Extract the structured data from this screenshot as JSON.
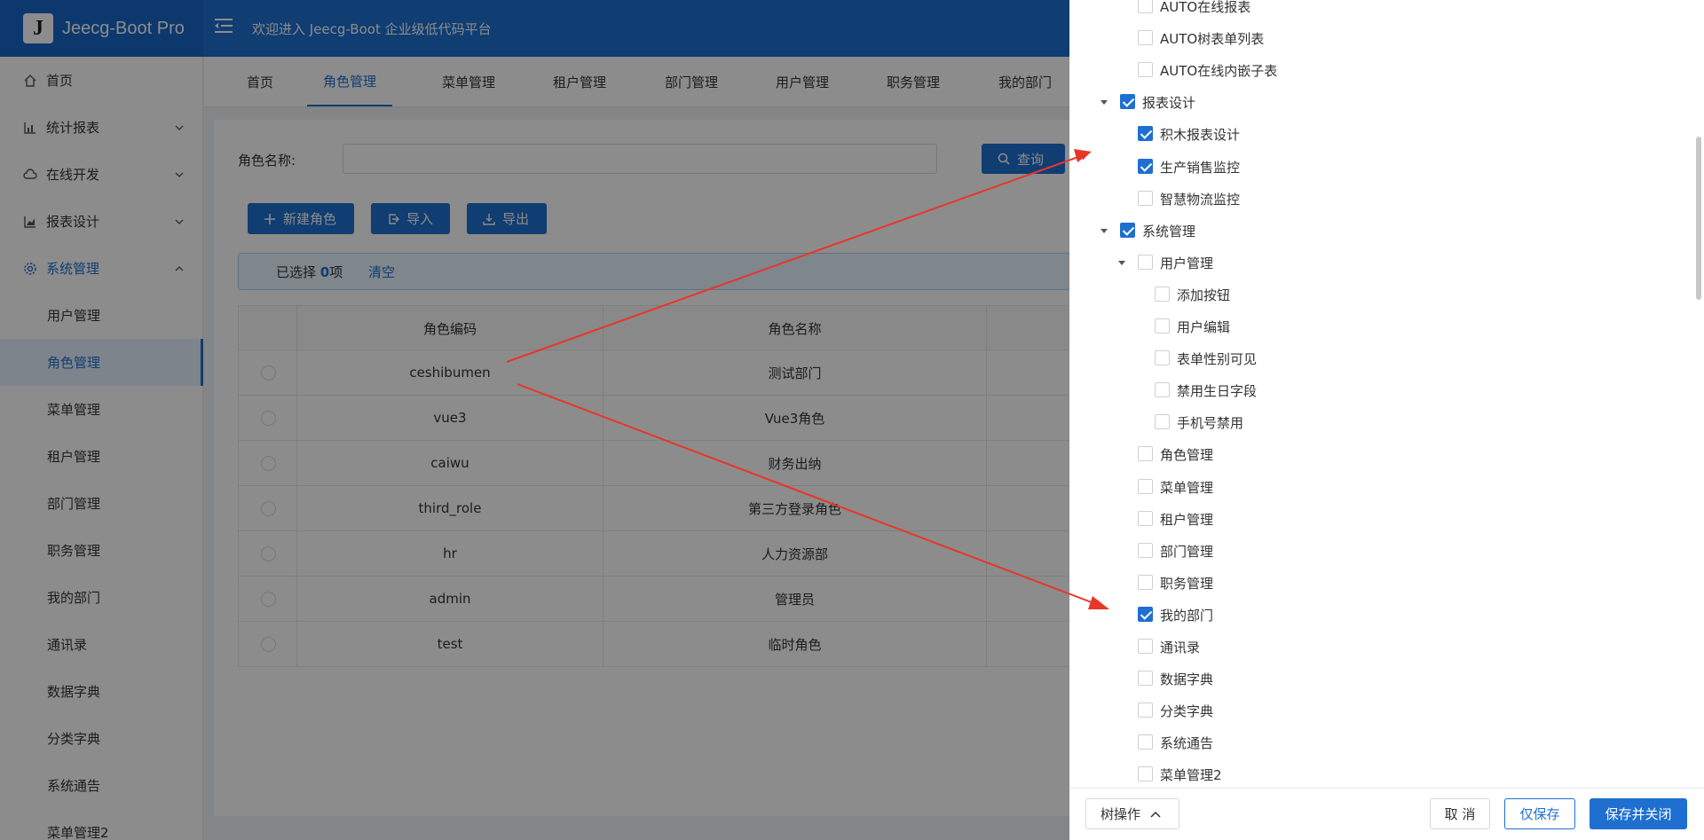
{
  "app": {
    "logo_letter": "J",
    "name": "Jeecg-Boot Pro",
    "welcome": "欢迎进入 Jeecg-Boot 企业级低代码平台"
  },
  "sidebar": {
    "top": [
      {
        "label": "首页",
        "icon": "home-icon"
      },
      {
        "label": "统计报表",
        "icon": "bar-chart-icon"
      },
      {
        "label": "在线开发",
        "icon": "cloud-icon"
      },
      {
        "label": "报表设计",
        "icon": "area-chart-icon"
      },
      {
        "label": "系统管理",
        "icon": "gear-icon"
      }
    ],
    "sub": [
      "用户管理",
      "角色管理",
      "菜单管理",
      "租户管理",
      "部门管理",
      "职务管理",
      "我的部门",
      "通讯录",
      "数据字典",
      "分类字典",
      "系统通告",
      "菜单管理2"
    ]
  },
  "tabs": [
    "首页",
    "角色管理",
    "菜单管理",
    "租户管理",
    "部门管理",
    "用户管理",
    "职务管理",
    "我的部门"
  ],
  "search": {
    "label": "角色名称:",
    "value": "",
    "query_button": "查询"
  },
  "toolbar": {
    "new_role": "新建角色",
    "import": "导入",
    "export": "导出"
  },
  "selection": {
    "prefix": "已选择",
    "count": "0",
    "suffix": "项",
    "clear": "清空"
  },
  "table": {
    "headers": [
      "角色编码",
      "角色名称"
    ],
    "rows": [
      {
        "code": "ceshibumen",
        "name": "测试部门"
      },
      {
        "code": "vue3",
        "name": "Vue3角色"
      },
      {
        "code": "caiwu",
        "name": "财务出纳"
      },
      {
        "code": "third_role",
        "name": "第三方登录角色"
      },
      {
        "code": "hr",
        "name": "人力资源部"
      },
      {
        "code": "admin",
        "name": "管理员"
      },
      {
        "code": "test",
        "name": "临时角色"
      }
    ]
  },
  "tree": [
    {
      "label": "AUTO在线报表",
      "level": 2,
      "checked": false,
      "caret": false
    },
    {
      "label": "AUTO树表单列表",
      "level": 2,
      "checked": false,
      "caret": false
    },
    {
      "label": "AUTO在线内嵌子表",
      "level": 2,
      "checked": false,
      "caret": false
    },
    {
      "label": "报表设计",
      "level": 1,
      "checked": true,
      "caret": true
    },
    {
      "label": "积木报表设计",
      "level": 2,
      "checked": true,
      "caret": false
    },
    {
      "label": "生产销售监控",
      "level": 2,
      "checked": true,
      "caret": false
    },
    {
      "label": "智慧物流监控",
      "level": 2,
      "checked": false,
      "caret": false
    },
    {
      "label": "系统管理",
      "level": 1,
      "checked": true,
      "caret": true
    },
    {
      "label": "用户管理",
      "level": 2,
      "checked": false,
      "caret": true
    },
    {
      "label": "添加按钮",
      "level": 3,
      "checked": false,
      "caret": false
    },
    {
      "label": "用户编辑",
      "level": 3,
      "checked": false,
      "caret": false
    },
    {
      "label": "表单性别可见",
      "level": 3,
      "checked": false,
      "caret": false
    },
    {
      "label": "禁用生日字段",
      "level": 3,
      "checked": false,
      "caret": false
    },
    {
      "label": "手机号禁用",
      "level": 3,
      "checked": false,
      "caret": false
    },
    {
      "label": "角色管理",
      "level": 2,
      "checked": false,
      "caret": false
    },
    {
      "label": "菜单管理",
      "level": 2,
      "checked": false,
      "caret": false
    },
    {
      "label": "租户管理",
      "level": 2,
      "checked": false,
      "caret": false
    },
    {
      "label": "部门管理",
      "level": 2,
      "checked": false,
      "caret": false
    },
    {
      "label": "职务管理",
      "level": 2,
      "checked": false,
      "caret": false
    },
    {
      "label": "我的部门",
      "level": 2,
      "checked": true,
      "caret": false
    },
    {
      "label": "通讯录",
      "level": 2,
      "checked": false,
      "caret": false
    },
    {
      "label": "数据字典",
      "level": 2,
      "checked": false,
      "caret": false
    },
    {
      "label": "分类字典",
      "level": 2,
      "checked": false,
      "caret": false
    },
    {
      "label": "系统通告",
      "level": 2,
      "checked": false,
      "caret": false
    },
    {
      "label": "菜单管理2",
      "level": 2,
      "checked": false,
      "caret": false
    }
  ],
  "footer": {
    "tree_ops": "树操作",
    "cancel": "取 消",
    "save": "仅保存",
    "save_close": "保存并关闭"
  },
  "colors": {
    "primary": "#1e6fd0",
    "arrow": "#e8352a"
  }
}
